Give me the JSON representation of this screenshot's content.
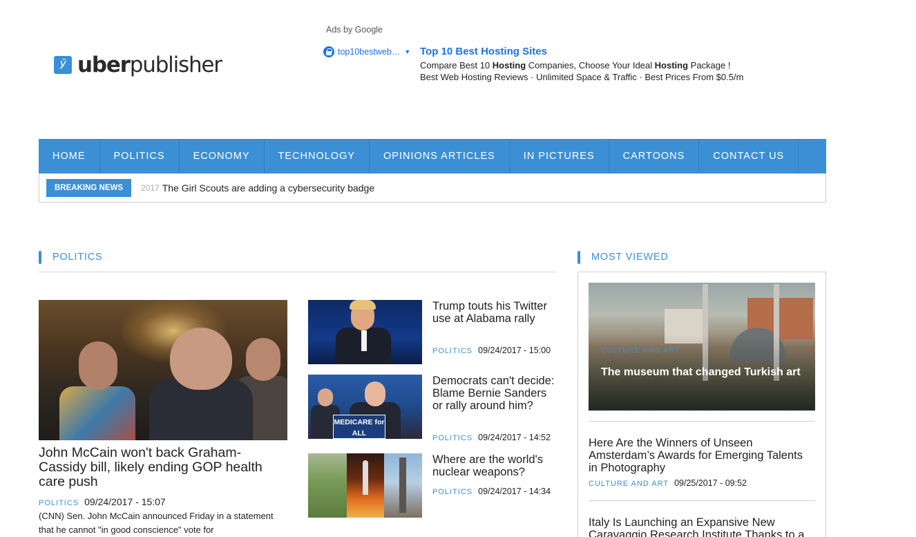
{
  "logo": {
    "mark": "Ӯ",
    "bold": "uber",
    "light": "publisher"
  },
  "ad": {
    "label": "Ads by Google",
    "domain": "top10bestweb…",
    "title": "Top 10 Best Hosting Sites",
    "desc_line1_html": "Compare Best 10 <b>Hosting</b> Companies, Choose Your Ideal <b>Hosting</b> Package !",
    "desc_line2": "Best Web Hosting Reviews · Unlimited Space & Traffic · Best Prices From $0.5/m"
  },
  "nav": {
    "items": [
      "HOME",
      "POLITICS",
      "ECONOMY",
      "TECHNOLOGY",
      "OPINIONS ARTICLES",
      "IN PICTURES",
      "CARTOONS",
      "CONTACT US"
    ]
  },
  "breaking": {
    "badge": "BREAKING NEWS",
    "year": "2017",
    "text": "The Girl Scouts are adding a cybersecurity badge"
  },
  "politics": {
    "heading": "POLITICS",
    "main": {
      "title": "John McCain won't back Graham-Cassidy bill, likely ending GOP health care push",
      "category": "POLITICS",
      "date": "09/24/2017 - 15:07",
      "excerpt": "(CNN) Sen. John McCain announced Friday in a statement that he cannot \"in good conscience\" vote for"
    },
    "side": [
      {
        "title": "Trump touts his Twitter use at Alabama rally",
        "category": "POLITICS",
        "date": "09/24/2017 - 15:00"
      },
      {
        "title": "Democrats can't decide: Blame Bernie Sanders or rally around him?",
        "category": "POLITICS",
        "date": "09/24/2017 - 14:52",
        "sign": "MEDICARE for ALL"
      },
      {
        "title": "Where are the world's nuclear weapons?",
        "category": "POLITICS",
        "date": "09/24/2017 - 14:34"
      }
    ]
  },
  "most_viewed": {
    "heading": "MOST VIEWED",
    "feature": {
      "category": "CULTURE AND ART",
      "title": "The museum that changed Turkish art"
    },
    "items": [
      {
        "title": "Here Are the Winners of Unseen Amsterdam’s Awards for Emerging Talents in Photography",
        "category": "CULTURE AND ART",
        "date": "09/25/2017 - 09:52"
      },
      {
        "title": "Italy Is Launching an Expansive New Caravaggio Research Institute Thanks to a"
      }
    ]
  },
  "colors": {
    "accent": "#3b8fd5",
    "ad_link": "#1a73e8"
  }
}
